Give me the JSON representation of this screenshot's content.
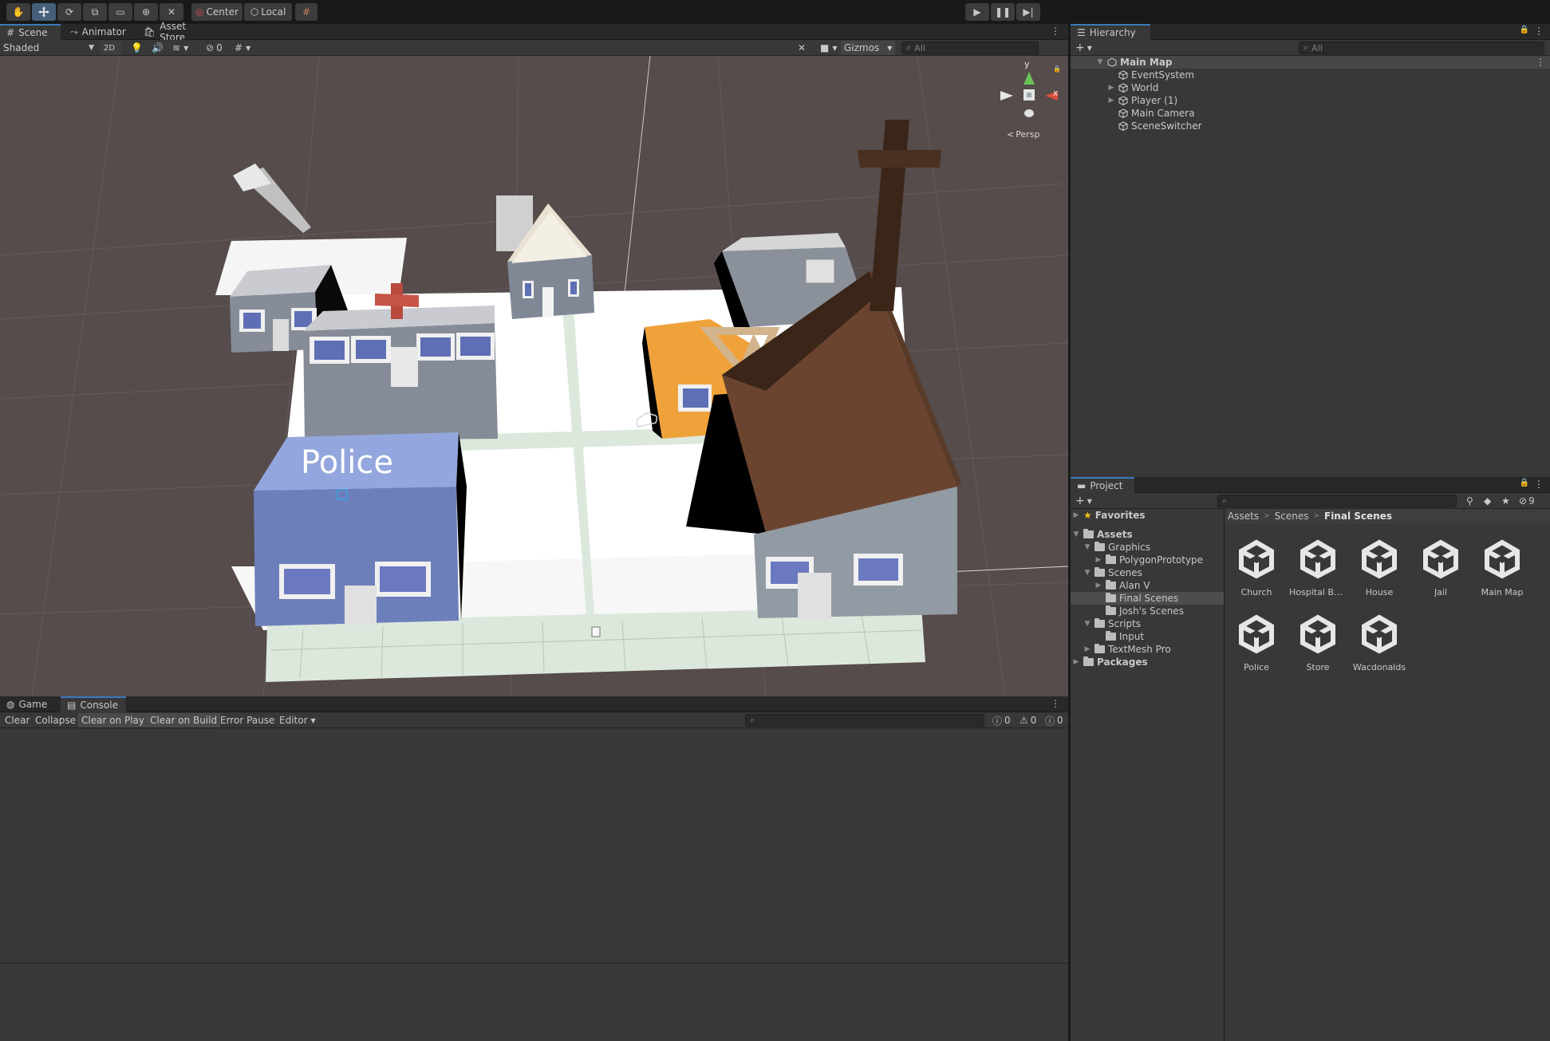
{
  "toolbar": {
    "center_label": "Center",
    "local_label": "Local"
  },
  "scene_tabs": [
    {
      "label": "Scene"
    },
    {
      "label": "Animator"
    },
    {
      "label": "Asset Store"
    }
  ],
  "scene_toolbar": {
    "shading_mode": "Shaded",
    "mode_2d": "2D",
    "hidden_count": "0",
    "gizmos_label": "Gizmos",
    "search_placeholder": "All"
  },
  "scene_view": {
    "persp_label": "Persp",
    "gizmo_y": "y",
    "gizmo_x": "x",
    "police_sign": "Police"
  },
  "hierarchy": {
    "title": "Hierarchy",
    "search_placeholder": "All",
    "scene_name": "Main Map",
    "items": [
      {
        "label": "EventSystem",
        "expandable": false
      },
      {
        "label": "World",
        "expandable": true
      },
      {
        "label": "Player (1)",
        "expandable": true
      },
      {
        "label": "Main Camera",
        "expandable": false
      },
      {
        "label": "SceneSwitcher",
        "expandable": false
      }
    ]
  },
  "project": {
    "title": "Project",
    "hidden_count": "9",
    "tree": {
      "favorites": "Favorites",
      "assets": "Assets",
      "graphics": "Graphics",
      "polygon": "PolygonPrototype",
      "scenes": "Scenes",
      "alan": "Alan V",
      "final": "Final Scenes",
      "josh": "Josh's Scenes",
      "scripts": "Scripts",
      "input": "Input",
      "textmesh": "TextMesh Pro",
      "packages": "Packages"
    },
    "breadcrumb": [
      "Assets",
      "Scenes",
      "Final Scenes"
    ],
    "assets": [
      "Church",
      "Hospital Bui...",
      "House",
      "Jail",
      "Main Map",
      "Police",
      "Store",
      "Wacdonalds"
    ]
  },
  "bottom_tabs": [
    {
      "label": "Game"
    },
    {
      "label": "Console"
    }
  ],
  "console": {
    "clear": "Clear",
    "collapse": "Collapse",
    "clear_on_play": "Clear on Play",
    "clear_on_build": "Clear on Build",
    "error_pause": "Error Pause",
    "editor": "Editor",
    "info_count": "0",
    "warn_count": "0",
    "error_count": "0"
  }
}
